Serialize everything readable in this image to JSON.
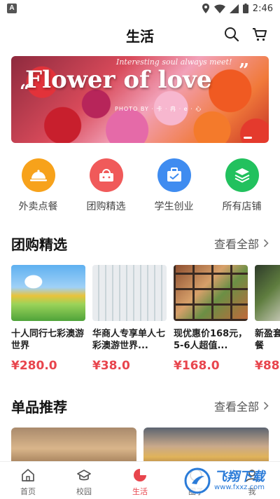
{
  "status_bar": {
    "time": "2:46",
    "notif_letter": "A"
  },
  "header": {
    "title": "生活",
    "icons": [
      "search-icon",
      "cart-icon"
    ]
  },
  "banner": {
    "subtitle": "Interesting soul always meet!",
    "title": "Flower of love",
    "quote_open": "“",
    "quote_close": "”",
    "credit": "PHOTO BY · 卡 · 冉 · e · 心"
  },
  "categories": [
    {
      "label": "外卖点餐",
      "icon": "cloche-icon",
      "color": "#f7a21b"
    },
    {
      "label": "团购精选",
      "icon": "basket-icon",
      "color": "#f05a5a"
    },
    {
      "label": "学生创业",
      "icon": "briefcase-icon",
      "color": "#3f8cf0"
    },
    {
      "label": "所有店铺",
      "icon": "layers-icon",
      "color": "#22c15e"
    }
  ],
  "group_section": {
    "title": "团购精选",
    "more": "查看全部"
  },
  "deals": [
    {
      "name": "十人同行七彩澳游世界",
      "price": "¥280.0"
    },
    {
      "name": "华商人专享单人七彩澳游世界...",
      "price": "¥38.0"
    },
    {
      "name": "现优惠价168元，5-6人超值...",
      "price": "¥168.0"
    },
    {
      "name": "新盈套餐",
      "price": "¥88"
    }
  ],
  "product_section": {
    "title": "单品推荐",
    "more": "查看全部"
  },
  "tabs": [
    {
      "label": "首页",
      "icon": "home-icon"
    },
    {
      "label": "校园",
      "icon": "campus-icon"
    },
    {
      "label": "生活",
      "icon": "life-icon"
    },
    {
      "label": "圈子",
      "icon": "circle-icon"
    },
    {
      "label": "我",
      "icon": "profile-icon"
    }
  ],
  "watermark": {
    "text": "飞翔下载",
    "url": "www.fxxz.com"
  },
  "colors": {
    "accent": "#e8454d",
    "text": "#222222"
  }
}
